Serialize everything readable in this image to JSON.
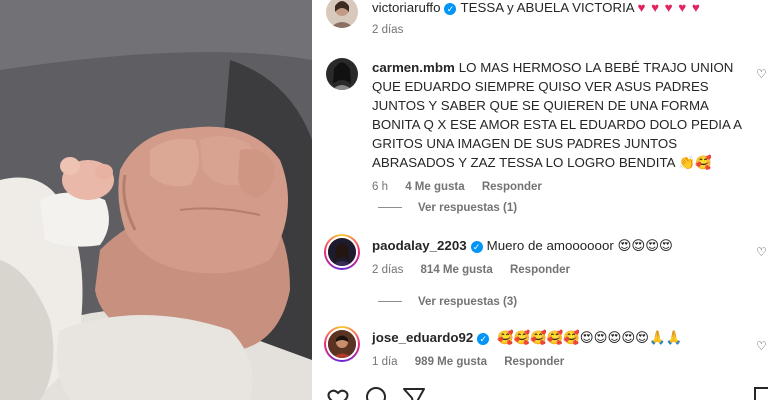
{
  "post": {
    "author": "victoriaruffo",
    "caption": "TESSA y ABUELA VICTORIA",
    "caption_emojis": "♥ ♥ ♥ ♥ ♥",
    "time": "2 días"
  },
  "comments": [
    {
      "user": "carmen.mbm",
      "text": "LO MAS HERMOSO LA BEBÉ TRAJO UNION QUE EDUARDO SIEMPRE QUISO VER ASUS PADRES JUNTOS Y SABER QUE SE QUIEREN DE UNA FORMA BONITA Q X ESE AMOR ESTA EL EDUARDO DOLO PEDIA A GRITOS UNA IMAGEN DE SUS PADRES JUNTOS ABRASADOS Y ZAZ TESSA LO LOGRO BENDITA",
      "emojis": "👏🥰",
      "time": "6 h",
      "likes": "4 Me gusta",
      "reply": "Responder",
      "replies": "Ver respuestas (1)"
    },
    {
      "user": "paodalay_2203",
      "text": "Muero de amoooooor",
      "emojis": "😍😍😍😍",
      "time": "2 días",
      "likes": "814 Me gusta",
      "reply": "Responder",
      "replies": "Ver respuestas (3)"
    },
    {
      "user": "jose_eduardo92",
      "text": "",
      "emojis": "🥰🥰🥰🥰🥰😍😍😍😍😍🙏🙏",
      "time": "1 día",
      "likes": "989 Me gusta",
      "reply": "Responder"
    }
  ],
  "icons": [
    "heart-outline",
    "comment-bubble",
    "share-plane",
    "bookmark"
  ]
}
